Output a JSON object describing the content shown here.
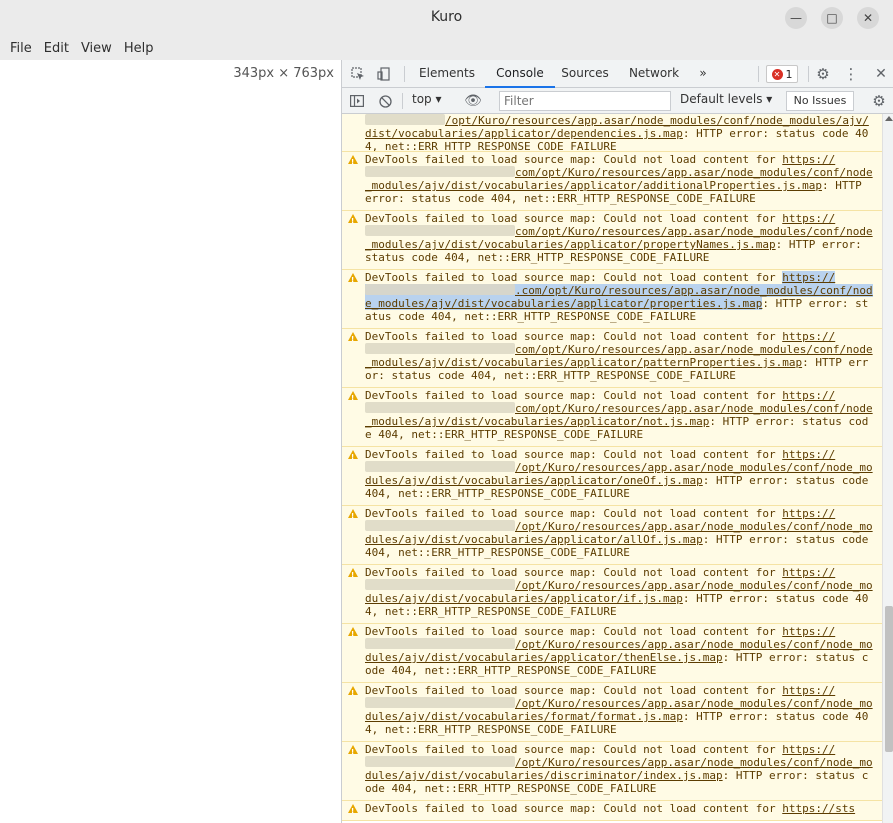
{
  "window": {
    "title": "Kuro",
    "minimize_icon": "minimize-icon",
    "maximize_icon": "maximize-icon",
    "close_icon": "close-icon"
  },
  "menu": [
    "File",
    "Edit",
    "View",
    "Help"
  ],
  "viewport": {
    "dimensions": "343px × 763px"
  },
  "devtools": {
    "tabs": [
      "Elements",
      "Console",
      "Sources",
      "Network"
    ],
    "active_tab": "Console",
    "more_tabs": "»",
    "error_count": "1",
    "context": "top",
    "filter_placeholder": "Filter",
    "levels": "Default levels",
    "issues": "No Issues"
  },
  "console": {
    "first_fragment": "/opt/Kuro/resources/app.asar/node_modules/conf/node_modules/ajv/dist/vocabularies/applicator/dependencies.js.map",
    "first_tail": ": HTTP error: status code 404, net::ERR_HTTP_RESPONSE_CODE_FAILURE",
    "prefix": "DevTools failed to load source map: Could not load content for ",
    "scheme": "https://",
    "suffix": ": HTTP error: status code 404, net::ERR_HTTP_RESPONSE_CODE_FAILURE",
    "messages": [
      {
        "path": "com/opt/Kuro/resources/app.asar/node_modules/conf/node_modules/ajv/dist/vocabularies/applicator/additionalProperties.js.map"
      },
      {
        "path": "com/opt/Kuro/resources/app.asar/node_modules/conf/node_modules/ajv/dist/vocabularies/applicator/propertyNames.js.map"
      },
      {
        "path": ".com/opt/Kuro/resources/app.asar/node_modules/conf/node_modules/ajv/dist/vocabularies/applicator/properties.js.map",
        "selected": true
      },
      {
        "path": "com/opt/Kuro/resources/app.asar/node_modules/conf/node_modules/ajv/dist/vocabularies/applicator/patternProperties.js.map"
      },
      {
        "path": "com/opt/Kuro/resources/app.asar/node_modules/conf/node_modules/ajv/dist/vocabularies/applicator/not.js.map"
      },
      {
        "path": "/opt/Kuro/resources/app.asar/node_modules/conf/node_modules/ajv/dist/vocabularies/applicator/oneOf.js.map"
      },
      {
        "path": "/opt/Kuro/resources/app.asar/node_modules/conf/node_modules/ajv/dist/vocabularies/applicator/allOf.js.map"
      },
      {
        "path": "/opt/Kuro/resources/app.asar/node_modules/conf/node_modules/ajv/dist/vocabularies/applicator/if.js.map"
      },
      {
        "path": "/opt/Kuro/resources/app.asar/node_modules/conf/node_modules/ajv/dist/vocabularies/applicator/thenElse.js.map"
      },
      {
        "path": "/opt/Kuro/resources/app.asar/node_modules/conf/node_modules/ajv/dist/vocabularies/format/format.js.map"
      },
      {
        "path": "/opt/Kuro/resources/app.asar/node_modules/conf/node_modules/ajv/dist/vocabularies/discriminator/index.js.map"
      },
      {
        "path": "",
        "scheme": "https://sts",
        "partial": true
      }
    ]
  },
  "colors": {
    "warning_bg": "#fffbe5",
    "warning_text": "#5c3c00",
    "selection": "#b9d2ee",
    "accent": "#1a73e8",
    "error": "#d93025"
  }
}
